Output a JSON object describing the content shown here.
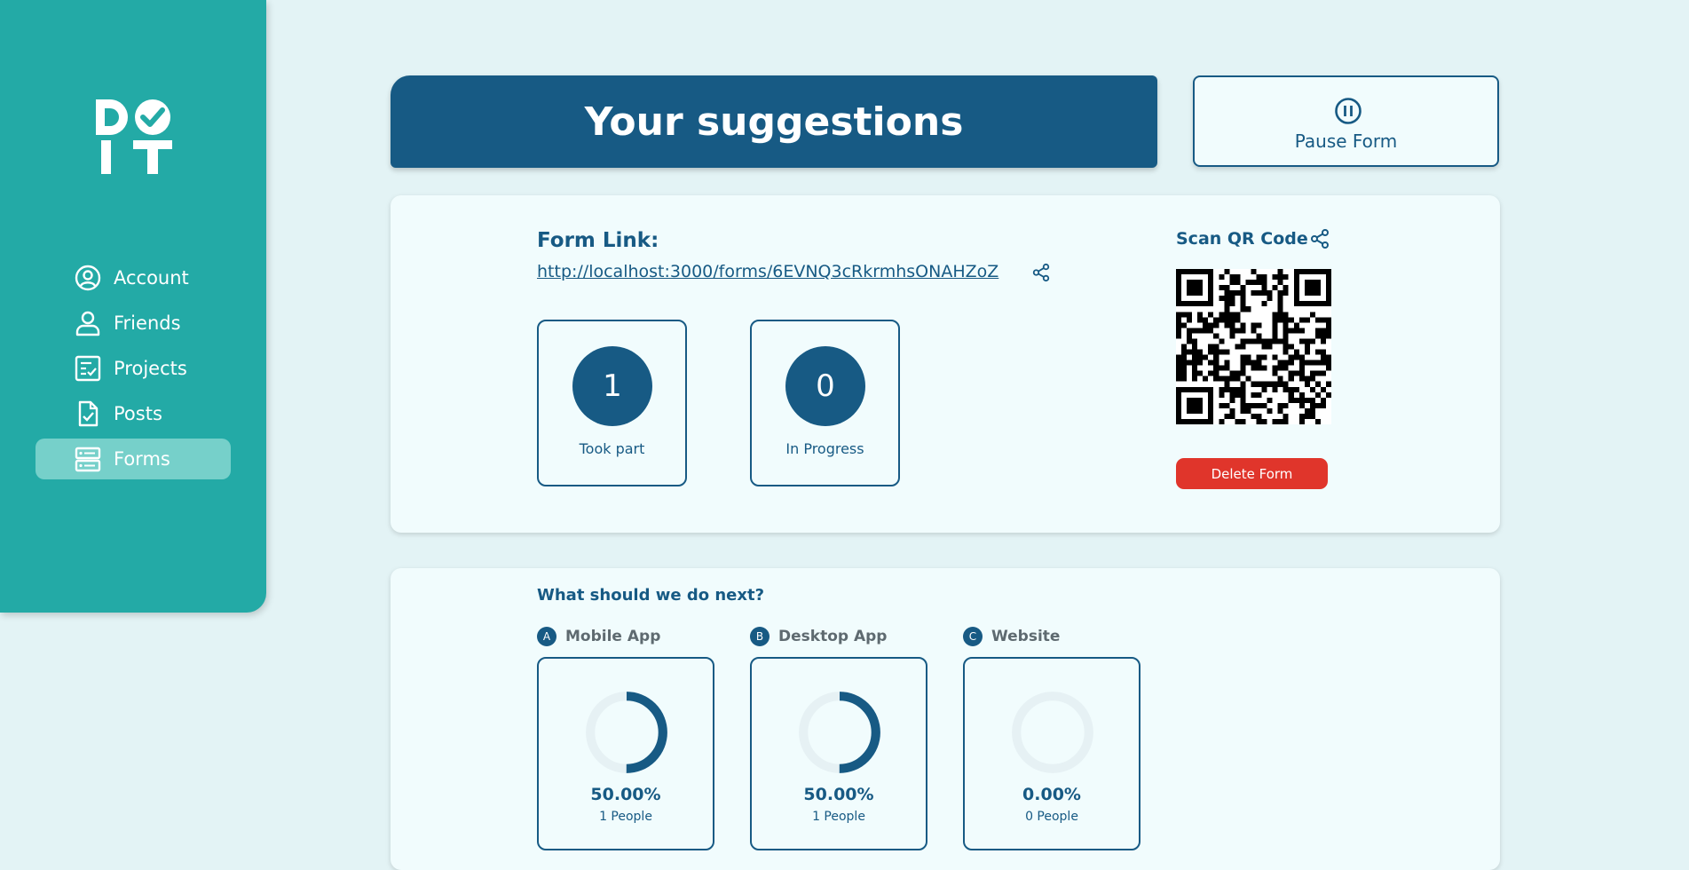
{
  "sidebar": {
    "logo_text": "DO IT",
    "items": [
      {
        "label": "Account",
        "icon": "account-circle-icon",
        "active": false
      },
      {
        "label": "Friends",
        "icon": "person-icon",
        "active": false
      },
      {
        "label": "Projects",
        "icon": "checklist-icon",
        "active": false
      },
      {
        "label": "Posts",
        "icon": "document-check-icon",
        "active": false
      },
      {
        "label": "Forms",
        "icon": "forms-icon",
        "active": true
      }
    ]
  },
  "header": {
    "title": "Your suggestions",
    "pause_label": "Pause Form"
  },
  "form_info": {
    "link_title": "Form Link:",
    "link_url": "http://localhost:3000/forms/6EVNQ3cRkrmhsONAHZoZ",
    "stats": [
      {
        "value": "1",
        "label": "Took part"
      },
      {
        "value": "0",
        "label": "In Progress"
      }
    ],
    "qr_title": "Scan QR Code",
    "delete_label": "Delete Form"
  },
  "question": {
    "title": "What should we do next?",
    "options": [
      {
        "letter": "A",
        "label": "Mobile App",
        "percent_text": "50.00%",
        "fraction": 0.5,
        "people": "1 People"
      },
      {
        "letter": "B",
        "label": "Desktop App",
        "percent_text": "50.00%",
        "fraction": 0.5,
        "people": "1 People"
      },
      {
        "letter": "C",
        "label": "Website",
        "percent_text": "0.00%",
        "fraction": 0.0,
        "people": "0 People"
      }
    ]
  },
  "colors": {
    "sidebar": "#23aaa6",
    "sidebar_active": "#76d0ca",
    "primary": "#175a84",
    "background": "#e3f3f5",
    "card": "#f1fcfd",
    "danger": "#e0352b",
    "donut_track": "#e6f1f4"
  }
}
